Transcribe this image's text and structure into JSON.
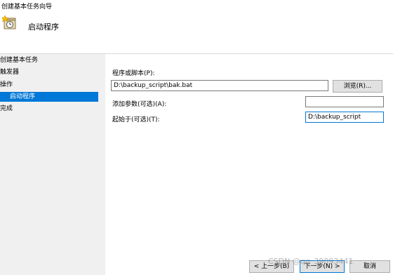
{
  "window": {
    "title": "创建基本任务向导"
  },
  "header": {
    "title": "启动程序",
    "icon": "task-clock-icon"
  },
  "sidebar": {
    "heading": "创建基本任务",
    "items": [
      {
        "label": "触发器"
      },
      {
        "label": "操作"
      },
      {
        "label": "启动程序"
      },
      {
        "label": "完成"
      }
    ]
  },
  "form": {
    "program_label": "程序或脚本(P):",
    "program_value": "D:\\backup_script\\bak.bat",
    "browse_label": "浏览(R)...",
    "args_label": "添加参数(可选)(A):",
    "args_value": "",
    "startin_label": "起始于(可选)(T):",
    "startin_value": "D:\\backup_script"
  },
  "footer": {
    "back_label": "< 上一步(B)",
    "next_label": "下一步(N) >",
    "cancel_label": "取消"
  },
  "watermark": {
    "text": "CSDN @qq_39093441"
  },
  "colors": {
    "accent": "#0078d7",
    "selected_bg": "#0078d7"
  }
}
